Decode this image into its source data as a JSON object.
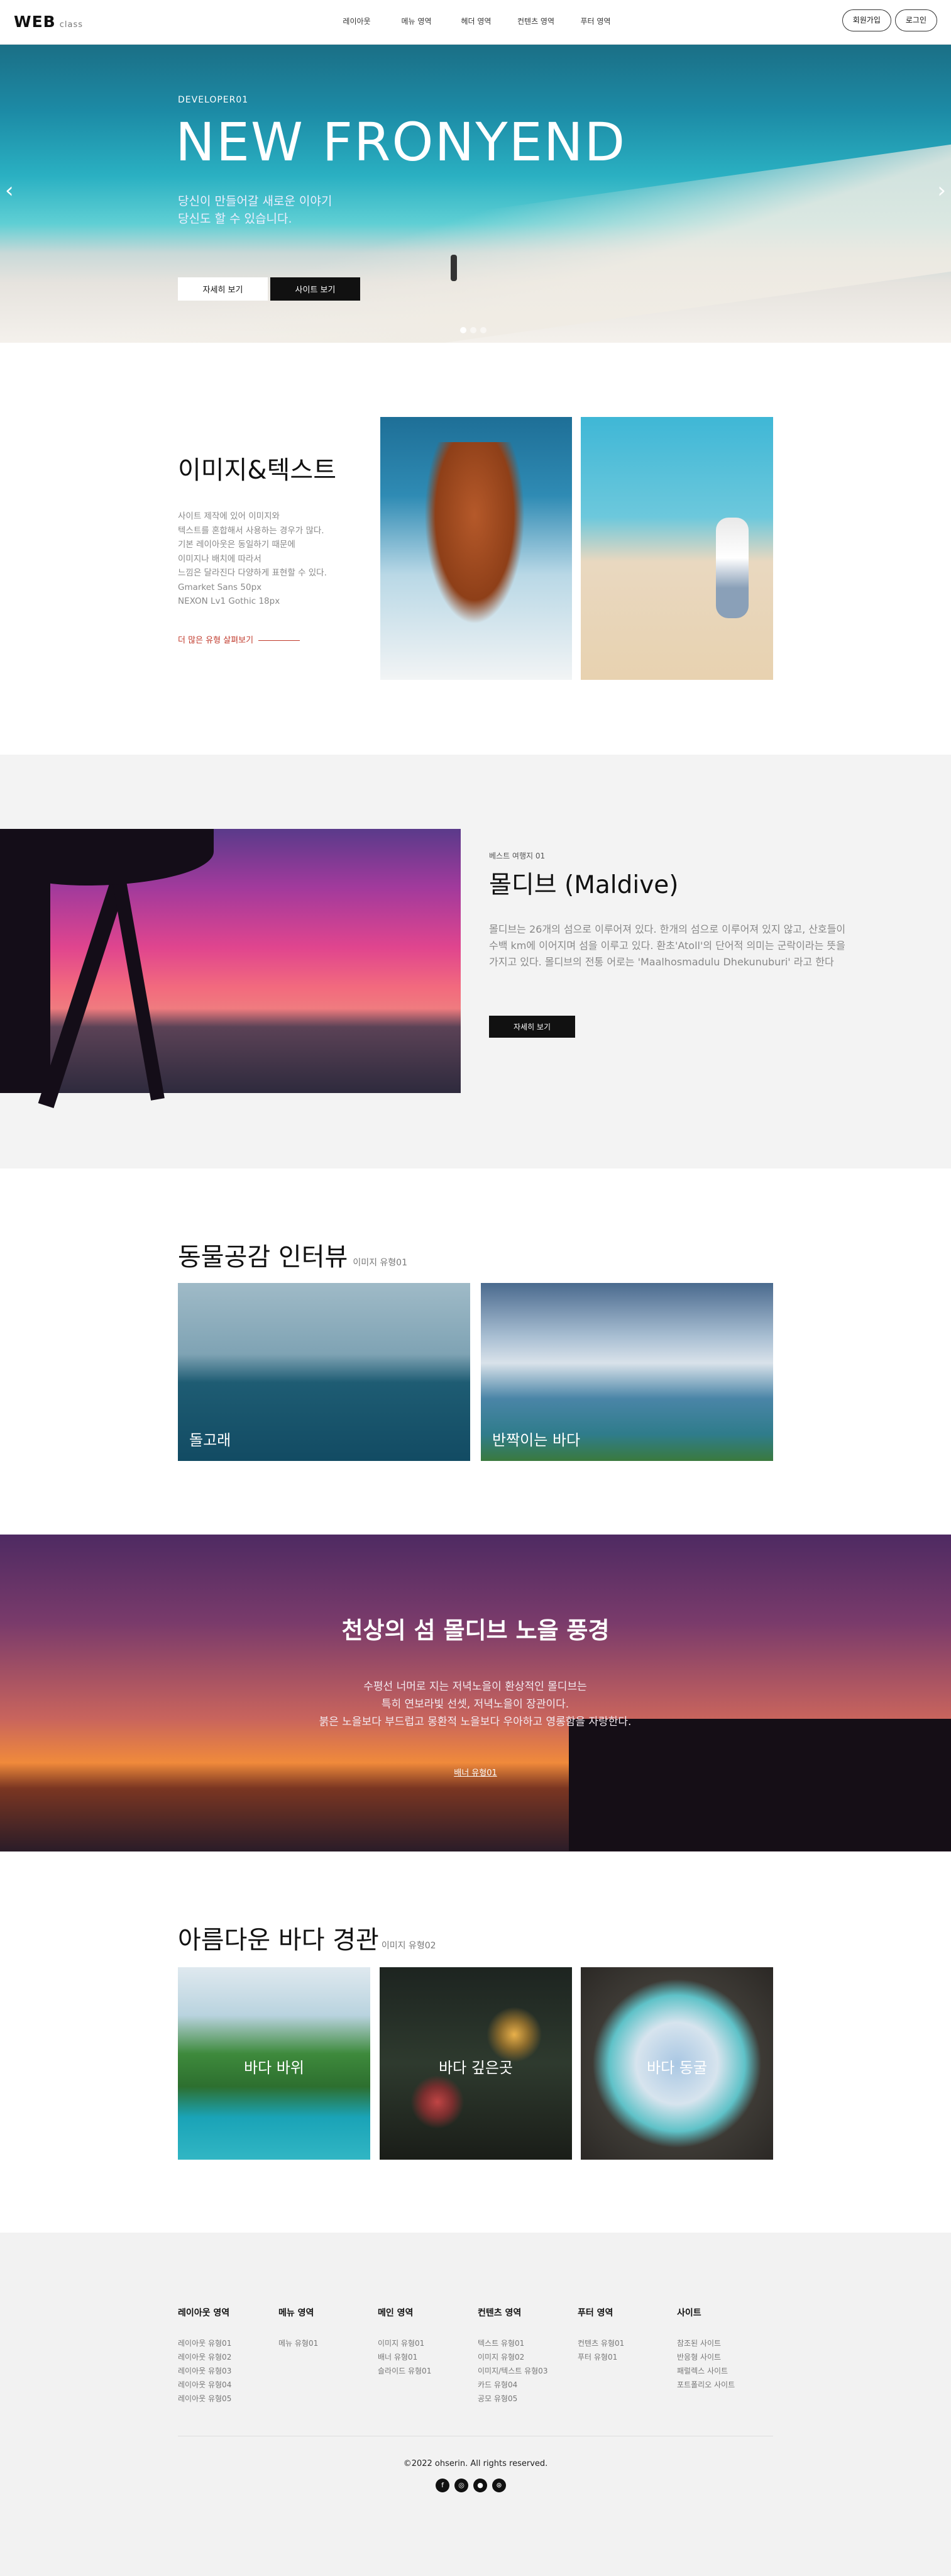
{
  "header": {
    "logo": "WEB",
    "logo_sub": "class",
    "nav": [
      "레이아웃",
      "메뉴 영역",
      "헤더 영역",
      "컨텐츠 영역",
      "푸터 영역"
    ],
    "join": "회원가입",
    "login": "로그인"
  },
  "hero": {
    "sub": "DEVELOPER01",
    "title": "NEW FRONYEND",
    "desc_lines": [
      "당신이 만들어갈 새로운 이야기",
      "당신도 할 수 있습니다."
    ],
    "btn_detail": "자세히 보기",
    "btn_site": "사이트 보기",
    "arrow_left": "‹",
    "arrow_right": "›"
  },
  "image_text": {
    "title": "이미지&텍스트",
    "lines": [
      "사이트 제작에 있어 이미지와",
      "텍스트를 혼합해서 사용하는 경우가 많다.",
      "기본 레이아웃은 동일하기 때문에",
      "이미지나 배치에 따라서",
      "느낌은 달라진다 다양하게 표현할 수 있다.",
      "Gmarket Sans 50px",
      "NEXON Lv1 Gothic 18px"
    ],
    "link": "더 많은 유형 살펴보기"
  },
  "maldive": {
    "small": "베스트 여행지 01",
    "title": "몰디브 (Maldive)",
    "desc": "몰디브는 26개의 섬으로 이루어져 있다. 한개의 섬으로 이루어져 있지 않고, 산호들이 수백 km에 이어지며 섬을 이루고 있다. 환초'Atoll'의 단어적 의미는 군락이라는 뜻을 가지고 있다. 몰디브의 전통 어로는 'Maalhosmadulu Dhekunuburi' 라고 한다",
    "btn": "자세히 보기"
  },
  "interview": {
    "title": "동물공감 인터뷰",
    "sub": "이미지 유형01",
    "cards": [
      "돌고래",
      "반짝이는 바다"
    ]
  },
  "banner": {
    "title": "천상의 섬 몰디브 노을 풍경",
    "desc_lines": [
      "수평선 너머로 지는 저녁노을이 환상적인 몰디브는",
      "특히 연보라빛 선셋, 저녁노을이 장관이다.",
      "붉은 노을보다 부드럽고 몽환적 노을보다 우아하고 영롱함을 자랑한다."
    ],
    "link": "배너 유형01"
  },
  "ocean": {
    "title": "아름다운 바다 경관",
    "sub": "이미지 유형02",
    "cards": [
      "바다 바위",
      "바다 깊은곳",
      "바다 동굴"
    ]
  },
  "footer": {
    "columns": [
      {
        "head": "레이아웃 영역",
        "links": [
          "레이아웃 유형01",
          "레이아웃 유형02",
          "레이아웃 유형03",
          "레이아웃 유형04",
          "레이아웃 유형05"
        ]
      },
      {
        "head": "메뉴 영역",
        "links": [
          "메뉴 유형01"
        ]
      },
      {
        "head": "메인 영역",
        "links": [
          "이미지 유형01",
          "배너 유형01",
          "슬라이드 유형01"
        ]
      },
      {
        "head": "컨텐츠 영역",
        "links": [
          "텍스트 유형01",
          "이미지 유형02",
          "이미지/텍스트 유형03",
          "카드 유형04",
          "공모 유형05"
        ]
      },
      {
        "head": "푸터 영역",
        "links": [
          "컨텐츠 유형01",
          "푸터 유형01"
        ]
      },
      {
        "head": "사이트",
        "links": [
          "참조된 사이트",
          "반응형 사이트",
          "패럴렉스 사이트",
          "포트폴리오 사이트"
        ]
      }
    ],
    "copyright": "©2022 ohserin. All rights reserved.",
    "icons": [
      "facebook-icon",
      "instagram-icon",
      "github-icon",
      "dribbble-icon"
    ]
  }
}
